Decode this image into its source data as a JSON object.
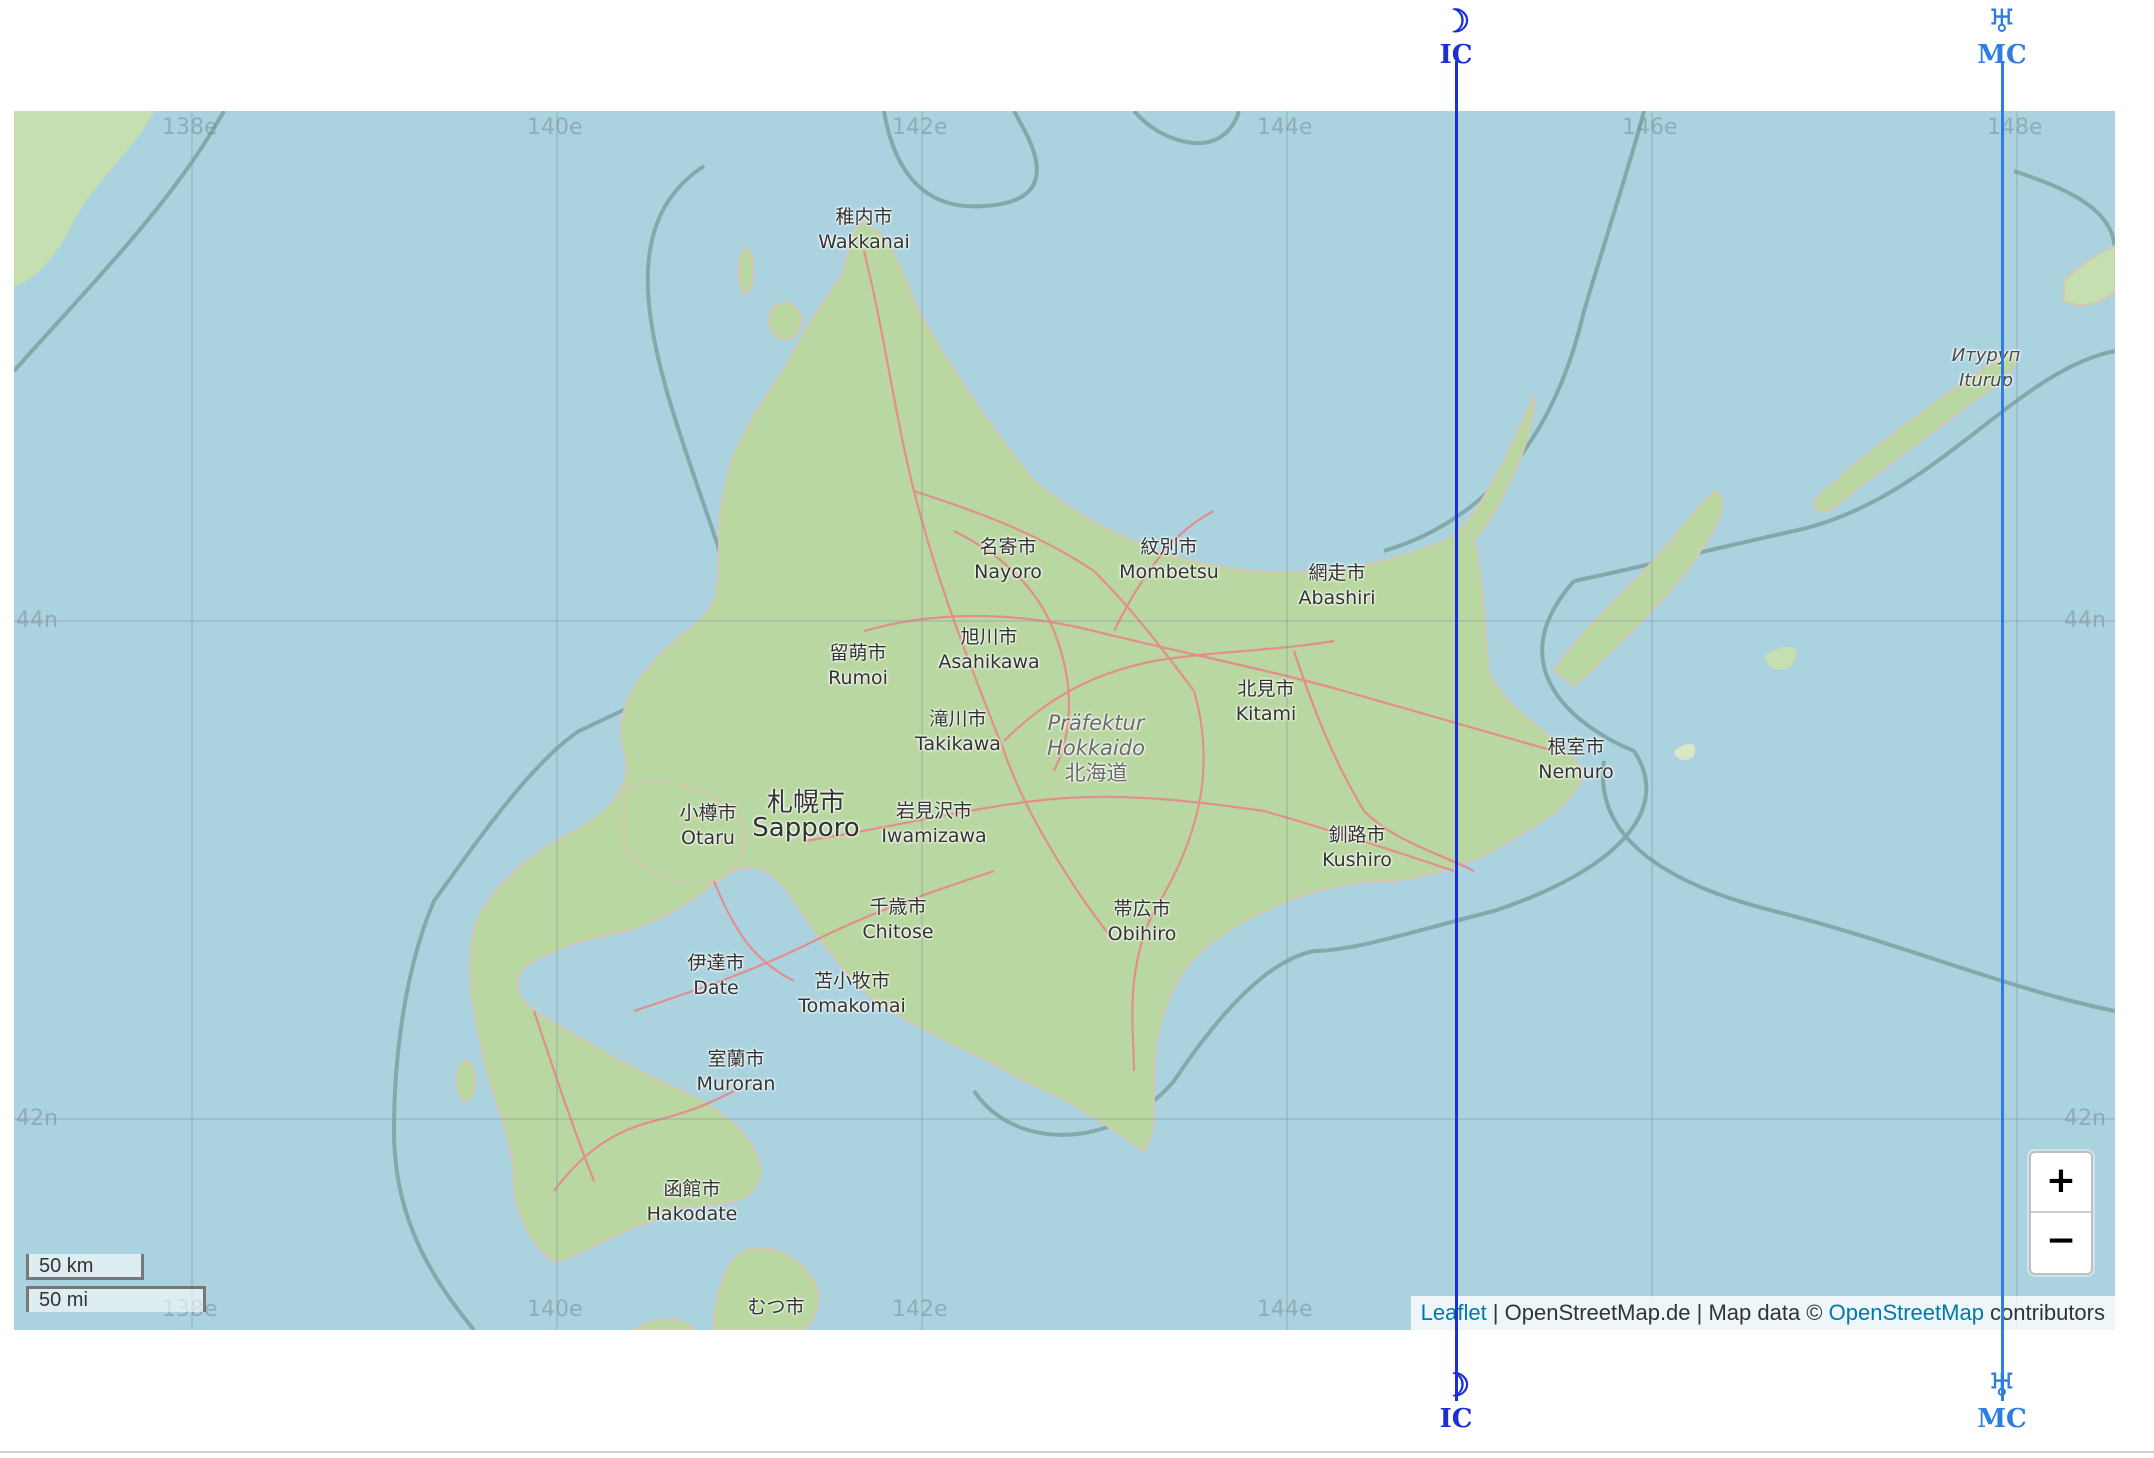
{
  "map": {
    "graticule_labels": {
      "longitude_top": [
        "138e",
        "140e",
        "142e",
        "144e",
        "146e",
        "148e"
      ],
      "longitude_bottom": [
        "138e",
        "140e",
        "142e",
        "144e"
      ],
      "latitude_left": [
        "44n",
        "42n"
      ],
      "latitude_right": [
        "44n",
        "42n"
      ]
    },
    "region": {
      "de": "Präfektur",
      "de2": "Hokkaido",
      "ja": "北海道"
    },
    "island": {
      "ru": "Итуруп",
      "en": "Iturup"
    },
    "cities": [
      {
        "ja": "稚内市",
        "en": "Wakkanai"
      },
      {
        "ja": "名寄市",
        "en": "Nayoro"
      },
      {
        "ja": "紋別市",
        "en": "Mombetsu"
      },
      {
        "ja": "網走市",
        "en": "Abashiri"
      },
      {
        "ja": "留萌市",
        "en": "Rumoi"
      },
      {
        "ja": "旭川市",
        "en": "Asahikawa"
      },
      {
        "ja": "北見市",
        "en": "Kitami"
      },
      {
        "ja": "滝川市",
        "en": "Takikawa"
      },
      {
        "ja": "根室市",
        "en": "Nemuro"
      },
      {
        "ja": "小樽市",
        "en": "Otaru"
      },
      {
        "ja": "札幌市",
        "en": "Sapporo"
      },
      {
        "ja": "岩見沢市",
        "en": "Iwamizawa"
      },
      {
        "ja": "釧路市",
        "en": "Kushiro"
      },
      {
        "ja": "千歳市",
        "en": "Chitose"
      },
      {
        "ja": "帯広市",
        "en": "Obihiro"
      },
      {
        "ja": "伊達市",
        "en": "Date"
      },
      {
        "ja": "苫小牧市",
        "en": "Tomakomai"
      },
      {
        "ja": "室蘭市",
        "en": "Muroran"
      },
      {
        "ja": "函館市",
        "en": "Hakodate"
      },
      {
        "ja": "むつ市",
        "en": ""
      }
    ],
    "zoom": {
      "in": "+",
      "out": "−"
    },
    "scale": {
      "km": "50 km",
      "mi": "50 mi"
    },
    "attribution": {
      "leaflet": "Leaflet",
      "sep1": " | OpenStreetMap.de | Map data © ",
      "osm": "OpenStreetMap",
      "tail": " contributors"
    },
    "colors": {
      "water": "#aad3df",
      "land": "#b9d7a0",
      "road": "#e8878a",
      "ic_line": "#1a2fd6",
      "mc_line": "#2e7de0"
    }
  },
  "angles": {
    "ic": {
      "glyph": "☽",
      "label": "IC"
    },
    "mc": {
      "glyph": "♅",
      "label": "MC"
    }
  }
}
